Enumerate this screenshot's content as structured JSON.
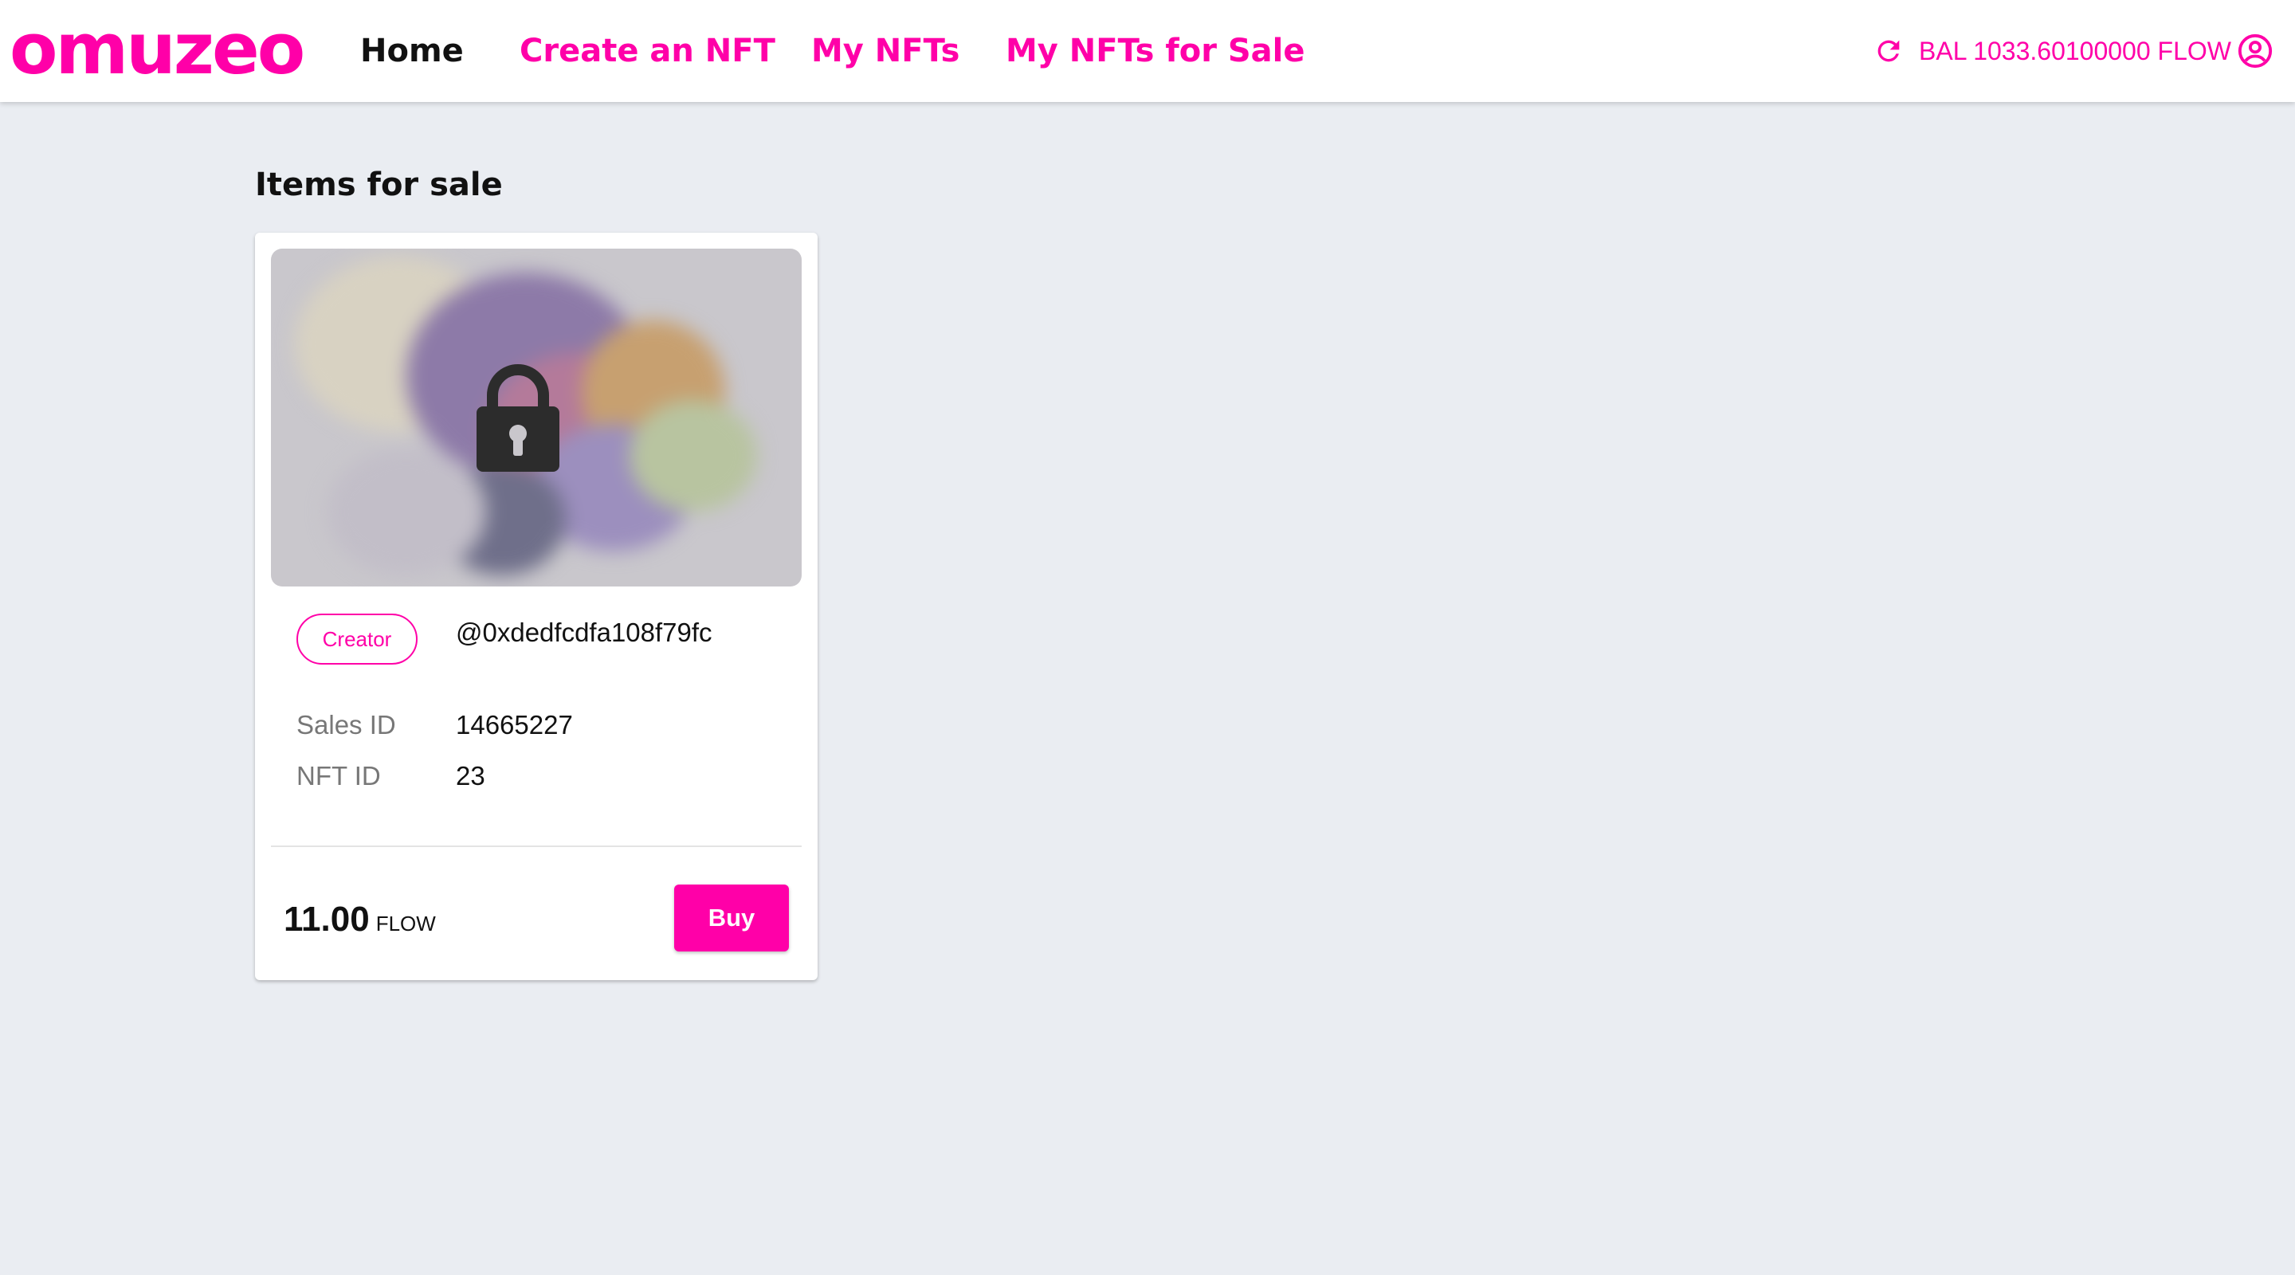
{
  "brand": {
    "logo_text": "omuzeo",
    "accent_color": "#ff00a8"
  },
  "nav": {
    "items": [
      {
        "label": "Home",
        "active": true
      },
      {
        "label": "Create an NFT",
        "active": false
      },
      {
        "label": "My NFTs",
        "active": false
      },
      {
        "label": "My NFTs for Sale",
        "active": false
      }
    ],
    "refresh_icon": "refresh-icon",
    "balance_text": "BAL 1033.60100000 FLOW",
    "account_icon": "account-circle-icon"
  },
  "main": {
    "section_title": "Items for sale",
    "items": [
      {
        "media_state": "locked",
        "media_icon": "lock-icon",
        "creator_chip": "Creator",
        "creator_address": "@0xdedfcdfa108f79fc",
        "sales_id_label": "Sales ID",
        "sales_id": "14665227",
        "nft_id_label": "NFT ID",
        "nft_id": "23",
        "price": "11.00",
        "currency": "FLOW",
        "buy_label": "Buy"
      }
    ]
  }
}
